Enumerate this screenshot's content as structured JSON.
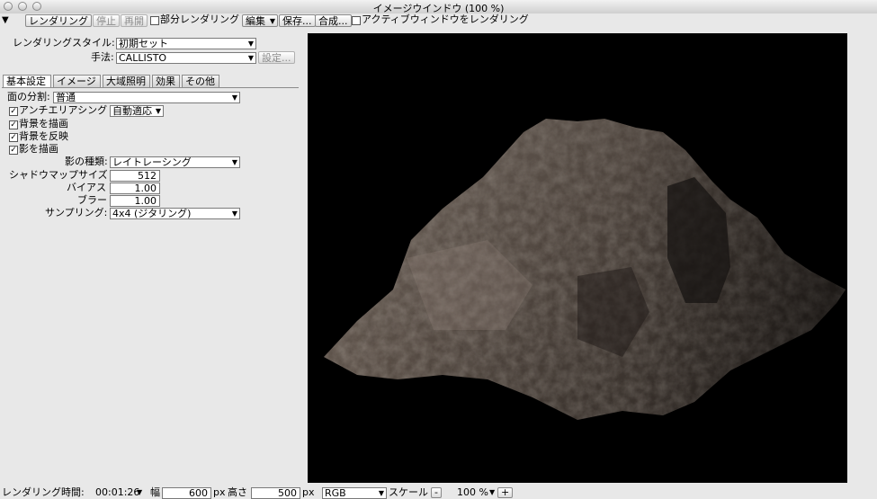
{
  "window": {
    "title": "イメージウインドウ (100 %)"
  },
  "toolbar": {
    "collapse_glyph": "▼",
    "render_label": "レンダリング",
    "stop_label": "停止",
    "resume_label": "再開",
    "partial_render_label": "部分レンダリング",
    "partial_render_checked": false,
    "edit_label": "編集",
    "save_label": "保存...",
    "composite_label": "合成...",
    "active_window_render_label": "アクティブウィンドウをレンダリング",
    "active_window_render_checked": false
  },
  "settings": {
    "style_label": "レンダリングスタイル:",
    "style_value": "初期セット",
    "method_label": "手法:",
    "method_value": "CALLISTO",
    "method_settings_button": "設定..."
  },
  "tabs": [
    {
      "label": "基本設定",
      "active": true
    },
    {
      "label": "イメージ",
      "active": false
    },
    {
      "label": "大域照明",
      "active": false
    },
    {
      "label": "効果",
      "active": false
    },
    {
      "label": "その他",
      "active": false
    }
  ],
  "basic": {
    "subdivision_label": "面の分割:",
    "subdivision_value": "普通",
    "antialias_label": "アンチエリアシング",
    "antialias_checked": true,
    "antialias_value": "自動適応",
    "draw_background_label": "背景を描画",
    "draw_background_checked": true,
    "reflect_background_label": "背景を反映",
    "reflect_background_checked": true,
    "draw_shadow_label": "影を描画",
    "draw_shadow_checked": true,
    "shadow_type_label": "影の種類:",
    "shadow_type_value": "レイトレーシング",
    "shadow_map_size_label": "シャドウマップサイズ",
    "shadow_map_size_value": "512",
    "bias_label": "バイアス",
    "bias_value": "1.00",
    "blur_label": "ブラー",
    "blur_value": "1.00",
    "sampling_label": "サンプリング:",
    "sampling_value": "4x4 (ジタリング)"
  },
  "status": {
    "render_time_label": "レンダリング時間:",
    "render_time_value": "00:01:26",
    "width_label": "幅",
    "width_value": "600",
    "width_unit": "px",
    "height_label": "高さ",
    "height_value": "500",
    "height_unit": "px",
    "color_mode_value": "RGB",
    "scale_label": "スケール",
    "scale_minus": "-",
    "zoom_value": "100 %",
    "scale_plus": "+"
  },
  "colors": {
    "render_background": "#000000",
    "rock_light": "#8a7d72",
    "rock_dark": "#2a2420"
  },
  "icons": {
    "close": "traffic-light-close",
    "minimize": "traffic-light-minimize",
    "zoom": "traffic-light-zoom",
    "dropdown": "chevron-down-icon"
  }
}
